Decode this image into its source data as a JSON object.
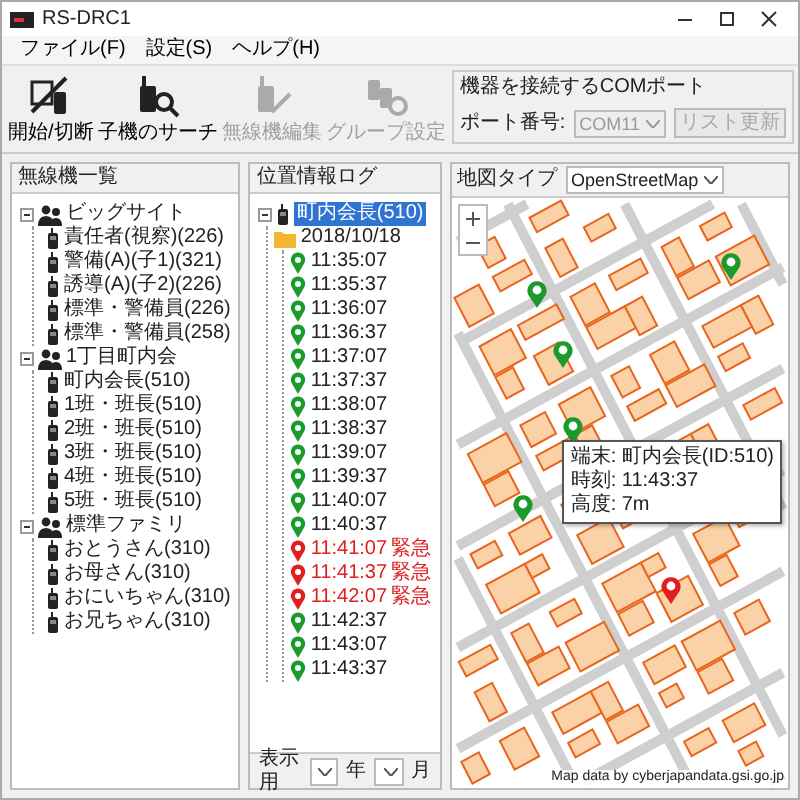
{
  "window": {
    "title": "RS-DRC1"
  },
  "menu": [
    "ファイル(F)",
    "設定(S)",
    "ヘルプ(H)"
  ],
  "toolbar": [
    {
      "label": "開始/切断",
      "disabled": false
    },
    {
      "label": "子機のサーチ",
      "disabled": false
    },
    {
      "label": "無線機編集",
      "disabled": true
    },
    {
      "label": "グループ設定",
      "disabled": true
    }
  ],
  "com_port": {
    "title": "機器を接続するCOMポート",
    "label": "ポート番号:",
    "value": "COM11",
    "disabled": true,
    "button": "リスト更新"
  },
  "radio_list": {
    "title": "無線機一覧",
    "groups": [
      {
        "name": "ビッグサイト",
        "expanded": true,
        "children": [
          {
            "name": "責任者(視察)(226)"
          },
          {
            "name": "警備(A)(子1)(321)"
          },
          {
            "name": "誘導(A)(子2)(226)"
          },
          {
            "name": "標準・警備員(226)"
          },
          {
            "name": "標準・警備員(258)"
          }
        ]
      },
      {
        "name": "1丁目町内会",
        "expanded": true,
        "children": [
          {
            "name": "町内会長(510)"
          },
          {
            "name": "1班・班長(510)"
          },
          {
            "name": "2班・班長(510)"
          },
          {
            "name": "3班・班長(510)"
          },
          {
            "name": "4班・班長(510)"
          },
          {
            "name": "5班・班長(510)"
          }
        ]
      },
      {
        "name": "標準ファミリ",
        "expanded": true,
        "children": [
          {
            "name": "おとうさん(310)"
          },
          {
            "name": "お母さん(310)"
          },
          {
            "name": "おにいちゃん(310)"
          },
          {
            "name": "お兄ちゃん(310)"
          }
        ]
      }
    ]
  },
  "location_log": {
    "title": "位置情報ログ",
    "device": "町内会長(510)",
    "selected": true,
    "expanded": true,
    "date": "2018/10/18",
    "entries": [
      {
        "time": "11:35:07",
        "alert": false
      },
      {
        "time": "11:35:37",
        "alert": false
      },
      {
        "time": "11:36:07",
        "alert": false
      },
      {
        "time": "11:36:37",
        "alert": false
      },
      {
        "time": "11:37:07",
        "alert": false
      },
      {
        "time": "11:37:37",
        "alert": false
      },
      {
        "time": "11:38:07",
        "alert": false
      },
      {
        "time": "11:38:37",
        "alert": false
      },
      {
        "time": "11:39:07",
        "alert": false
      },
      {
        "time": "11:39:37",
        "alert": false
      },
      {
        "time": "11:40:07",
        "alert": false
      },
      {
        "time": "11:40:37",
        "alert": false
      },
      {
        "time": "11:41:07",
        "alert": true,
        "alert_label": "緊急"
      },
      {
        "time": "11:41:37",
        "alert": true,
        "alert_label": "緊急"
      },
      {
        "time": "11:42:07",
        "alert": true,
        "alert_label": "緊急"
      },
      {
        "time": "11:42:37",
        "alert": false
      },
      {
        "time": "11:43:07",
        "alert": false
      },
      {
        "time": "11:43:37",
        "alert": false
      }
    ],
    "footer": {
      "label": "表示用",
      "year_unit": "年",
      "month_unit": "月"
    }
  },
  "map": {
    "type_label": "地図タイプ",
    "type_value": "OpenStreetMap",
    "pins": [
      {
        "kind": "normal"
      },
      {
        "kind": "normal"
      },
      {
        "kind": "normal"
      },
      {
        "kind": "normal"
      },
      {
        "kind": "normal"
      },
      {
        "kind": "alert"
      }
    ],
    "tooltip": [
      "端末: 町内会長(ID:510)",
      "時刻: 11:43:37",
      "高度: 7m"
    ],
    "attribution": "Map data by cyberjapandata.gsi.go.jp"
  }
}
